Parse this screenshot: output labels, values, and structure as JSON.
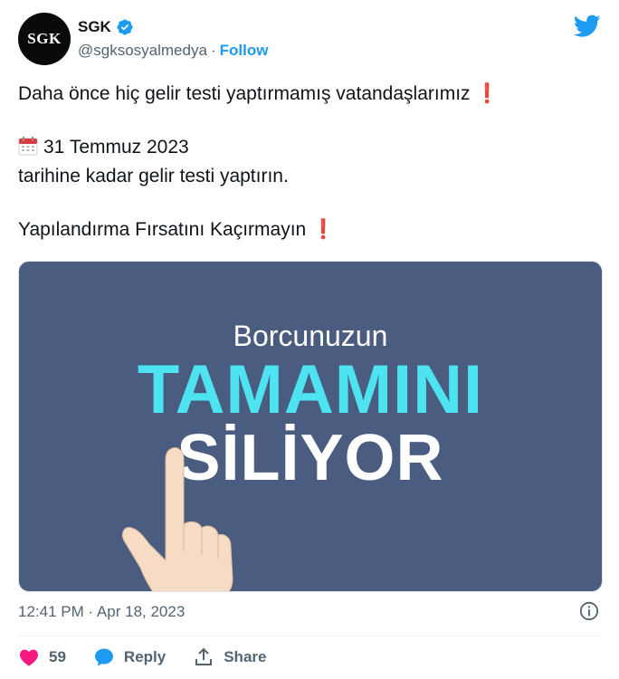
{
  "author": {
    "avatar_text": "SGK",
    "display_name": "SGK",
    "handle": "@sgksosyalmedya",
    "separator": "·",
    "follow_label": "Follow"
  },
  "tweet": {
    "line1": "Daha önce hiç gelir testi yaptırmamış vatandaşlarımız",
    "line1_mark": "❗",
    "date_line": "31 Temmuz 2023",
    "line3": "tarihine kadar gelir testi yaptırın.",
    "line4": "Yapılandırma Fırsatını Kaçırmayın",
    "line4_mark": "❗"
  },
  "media": {
    "line1": "Borcunuzun",
    "line2": "TAMAMINI",
    "line3": "SİLİYOR",
    "background_color": "#4a5c80",
    "accent_color": "#4ee3f0"
  },
  "meta": {
    "timestamp": "12:41 PM · Apr 18, 2023"
  },
  "actions": {
    "like_count": "59",
    "reply_label": "Reply",
    "share_label": "Share"
  },
  "colors": {
    "brand_blue": "#1d9bf0",
    "like_red": "#f91880",
    "muted": "#536471"
  }
}
